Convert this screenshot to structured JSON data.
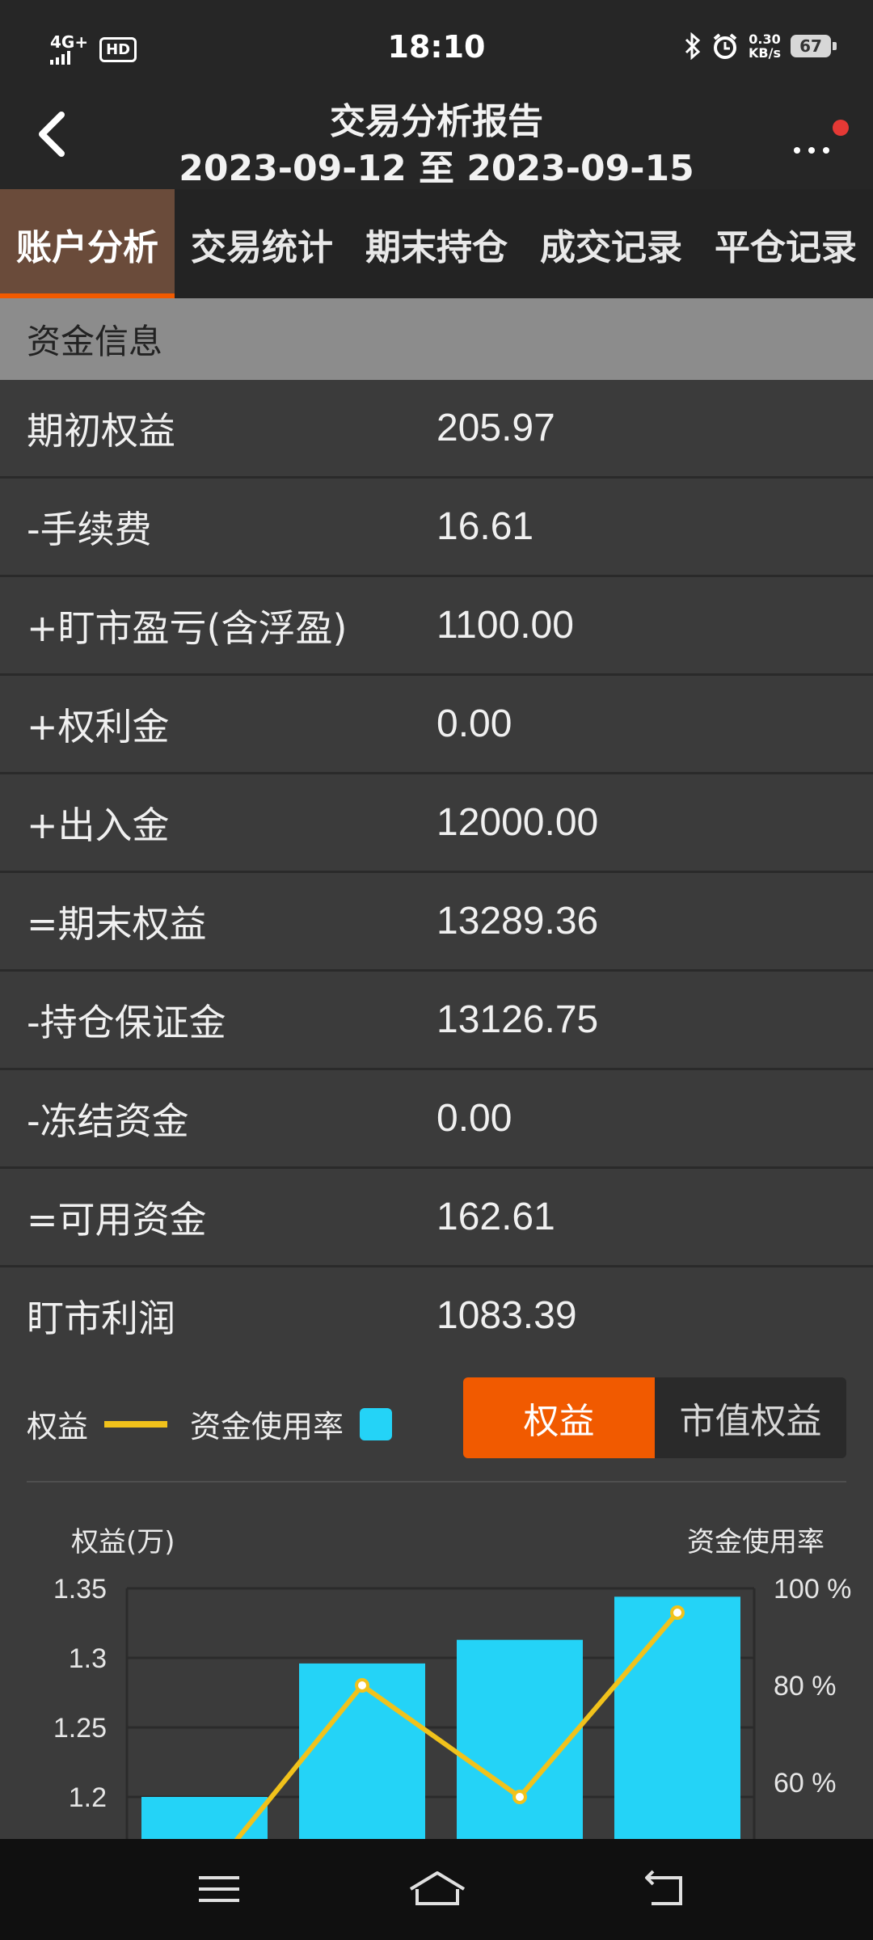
{
  "status_bar": {
    "network": "4G+",
    "hd": "HD",
    "time": "18:10",
    "speed_value": "0.30",
    "speed_unit": "KB/s",
    "battery": "67",
    "icons": [
      "signal-icon",
      "bluetooth-icon",
      "alarm-icon",
      "battery-icon"
    ]
  },
  "header": {
    "title": "交易分析报告",
    "subtitle": "2023-09-12 至 2023-09-15"
  },
  "tabs": [
    {
      "label": "账户分析",
      "active": true
    },
    {
      "label": "交易统计",
      "active": false
    },
    {
      "label": "期末持仓",
      "active": false
    },
    {
      "label": "成交记录",
      "active": false
    },
    {
      "label": "平仓记录",
      "active": false
    }
  ],
  "section": {
    "title": "资金信息"
  },
  "rows": [
    {
      "label": "期初权益",
      "value": "205.97"
    },
    {
      "label": "-手续费",
      "value": "16.61"
    },
    {
      "label": "+盯市盈亏(含浮盈)",
      "value": "1100.00"
    },
    {
      "label": "+权利金",
      "value": "0.00"
    },
    {
      "label": "+出入金",
      "value": "12000.00"
    },
    {
      "label": "=期末权益",
      "value": "13289.36"
    },
    {
      "label": "-持仓保证金",
      "value": "13126.75"
    },
    {
      "label": "-冻结资金",
      "value": "0.00"
    },
    {
      "label": "=可用资金",
      "value": "162.61"
    },
    {
      "label": "盯市利润",
      "value": "1083.39"
    }
  ],
  "chart_panel": {
    "legend_equity": "权益",
    "legend_usage": "资金使用率",
    "toggle_on": "权益",
    "toggle_off": "市值权益"
  },
  "colors": {
    "accent": "#f15a00",
    "bar": "#24d3f7",
    "line": "#f1c21b",
    "active_tab_bg": "#6a4b3a"
  },
  "chart_data": {
    "type": "bar",
    "ylabel": "权益(万)",
    "y2label": "资金使用率",
    "y_ticks": [
      "1.35",
      "1.3",
      "1.25",
      "1.2"
    ],
    "y2_ticks": [
      "100 %",
      "80 %",
      "60 %"
    ],
    "series": [
      {
        "name": "资金使用率",
        "type": "bar",
        "values": [
          1.2,
          1.296,
          1.313,
          1.344
        ]
      },
      {
        "name": "权益",
        "type": "line",
        "values": [
          40,
          80,
          57,
          95
        ]
      }
    ]
  }
}
